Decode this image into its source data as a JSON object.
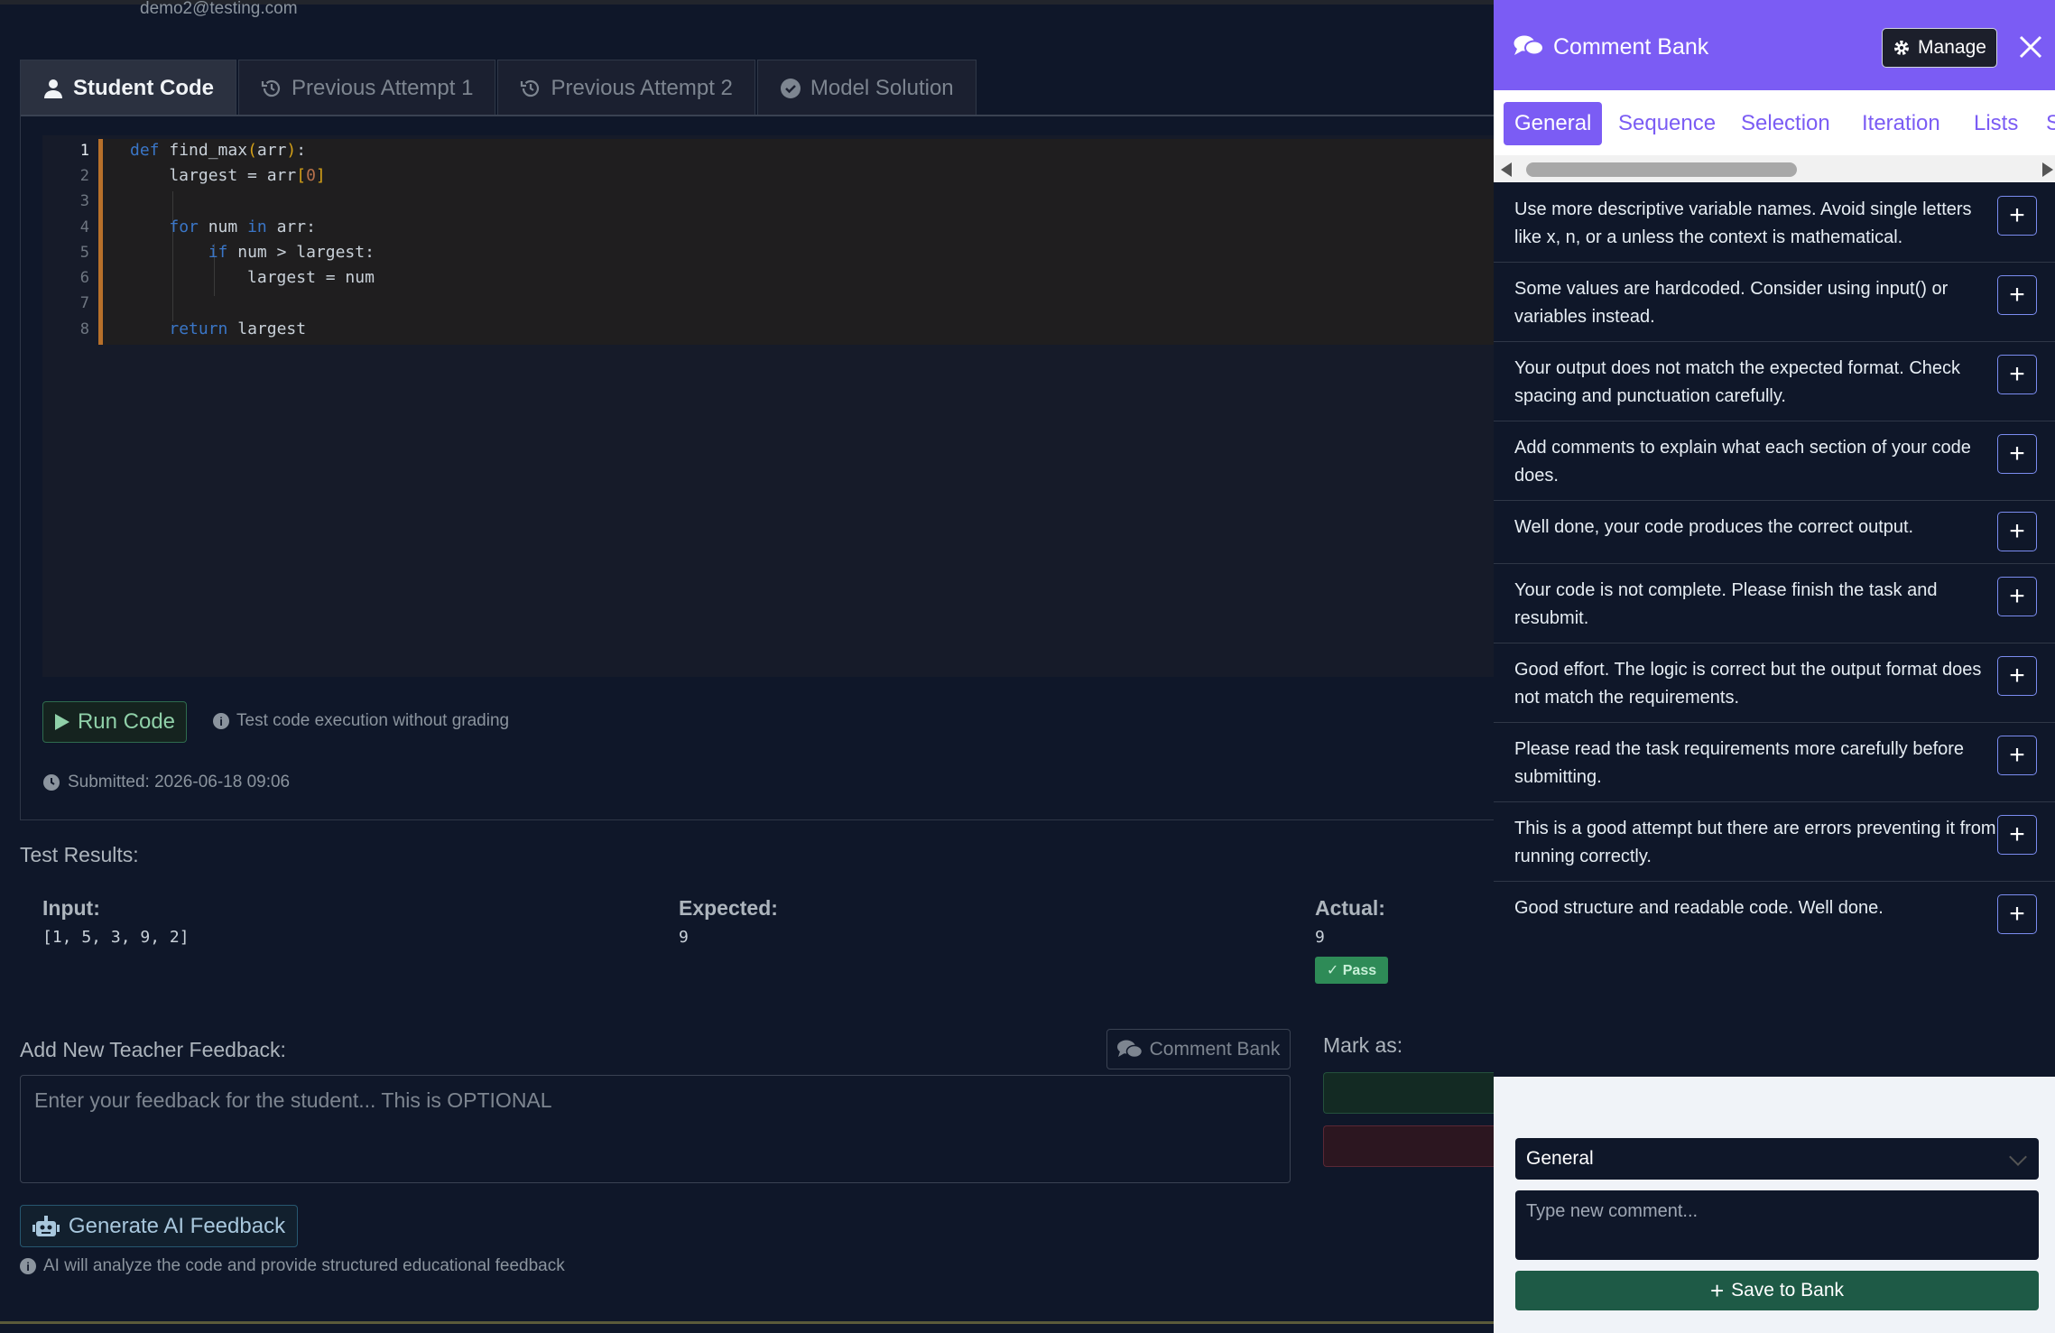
{
  "header": {
    "user_email": "demo2@testing.com"
  },
  "code_tabs": [
    {
      "label": "Student Code",
      "icon": "user-icon",
      "active": true
    },
    {
      "label": "Previous Attempt 1",
      "icon": "history-icon",
      "active": false
    },
    {
      "label": "Previous Attempt 2",
      "icon": "history-icon",
      "active": false
    },
    {
      "label": "Model Solution",
      "icon": "check-circle-icon",
      "active": false
    }
  ],
  "editor": {
    "line_numbers": [
      "1",
      "2",
      "3",
      "4",
      "5",
      "6",
      "7",
      "8"
    ],
    "lines": [
      "def find_max(arr):",
      "    largest = arr[0]",
      "",
      "    for num in arr:",
      "        if num > largest:",
      "            largest = num",
      "",
      "    return largest"
    ]
  },
  "run": {
    "button_label": "Run Code",
    "hint": "Test code execution without grading",
    "submitted": "Submitted: 2026-06-18 09:06"
  },
  "test_results": {
    "title": "Test Results:",
    "input_label": "Input:",
    "input_value": "[1, 5, 3, 9, 2]",
    "expected_label": "Expected:",
    "expected_value": "9",
    "actual_label": "Actual:",
    "actual_value": "9",
    "status": "✓ Pass",
    "status_color": "#2e8b57"
  },
  "feedback": {
    "label": "Add New Teacher Feedback:",
    "comment_bank_button": "Comment Bank",
    "placeholder": "Enter your feedback for the student... This is OPTIONAL",
    "mark_as_label": "Mark as:",
    "ai_button": "Generate AI Feedback",
    "ai_hint": "AI will analyze the code and provide structured educational feedback"
  },
  "comment_bank": {
    "title": "Comment Bank",
    "manage_label": "Manage",
    "accent_color": "#7b5cf4",
    "tabs": [
      {
        "label": "General",
        "active": true
      },
      {
        "label": "Sequence",
        "active": false
      },
      {
        "label": "Selection",
        "active": false
      },
      {
        "label": "Iteration",
        "active": false
      },
      {
        "label": "Lists",
        "active": false
      },
      {
        "label": "S",
        "active": false
      }
    ],
    "comments": [
      "Use more descriptive variable names. Avoid single letters like x, n, or a unless the context is mathematical.",
      "Some values are hardcoded. Consider using input() or variables instead.",
      "Your output does not match the expected format. Check spacing and punctuation carefully.",
      "Add comments to explain what each section of your code does.",
      "Well done, your code produces the correct output.",
      "Your code is not complete. Please finish the task and resubmit.",
      "Good effort. The logic is correct but the output format does not match the requirements.",
      "Please read the task requirements more carefully before submitting.",
      "This is a good attempt but there are errors preventing it from running correctly.",
      "Good structure and readable code. Well done."
    ],
    "category_select": "General",
    "new_comment_placeholder": "Type new comment...",
    "save_button": "Save to Bank"
  }
}
